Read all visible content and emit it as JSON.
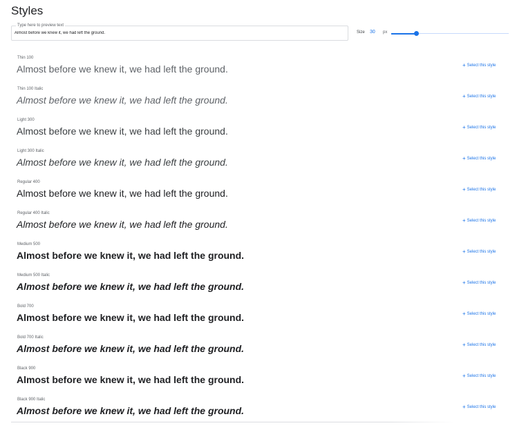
{
  "header": {
    "title": "Styles"
  },
  "preview": {
    "label": "Type here to preview text",
    "value": "Almost before we knew it, we had left the ground."
  },
  "size": {
    "label": "Size",
    "value": "30",
    "unit": "px",
    "slider_fraction": 0.21
  },
  "accent_color": "#1a73e8",
  "select_label": "Select this style",
  "styles": [
    {
      "name": "Thin 100",
      "sample": "Almost before we knew it, we had left the ground.",
      "select": "Select this style"
    },
    {
      "name": "Thin 100 Italic",
      "sample": "Almost before we knew it, we had left the ground.",
      "select": "Select this style"
    },
    {
      "name": "Light 300",
      "sample": "Almost before we knew it, we had left the ground.",
      "select": "Select this style"
    },
    {
      "name": "Light 300 Italic",
      "sample": "Almost before we knew it, we had left the ground.",
      "select": "Select this style"
    },
    {
      "name": "Regular 400",
      "sample": "Almost before we knew it, we had left the ground.",
      "select": "Select this style"
    },
    {
      "name": "Regular 400 Italic",
      "sample": "Almost before we knew it, we had left the ground.",
      "select": "Select this style"
    },
    {
      "name": "Medium 500",
      "sample": "Almost before we knew it, we had left the ground.",
      "select": "Select this style"
    },
    {
      "name": "Medium 500 Italic",
      "sample": "Almost before we knew it, we had left the ground.",
      "select": "Select this style"
    },
    {
      "name": "Bold 700",
      "sample": "Almost before we knew it, we had left the ground.",
      "select": "Select this style"
    },
    {
      "name": "Bold 700 Italic",
      "sample": "Almost before we knew it, we had left the ground.",
      "select": "Select this style"
    },
    {
      "name": "Black 900",
      "sample": "Almost before we knew it, we had left the ground.",
      "select": "Select this style"
    },
    {
      "name": "Black 900 Italic",
      "sample": "Almost before we knew it, we had left the ground.",
      "select": "Select this style"
    }
  ]
}
